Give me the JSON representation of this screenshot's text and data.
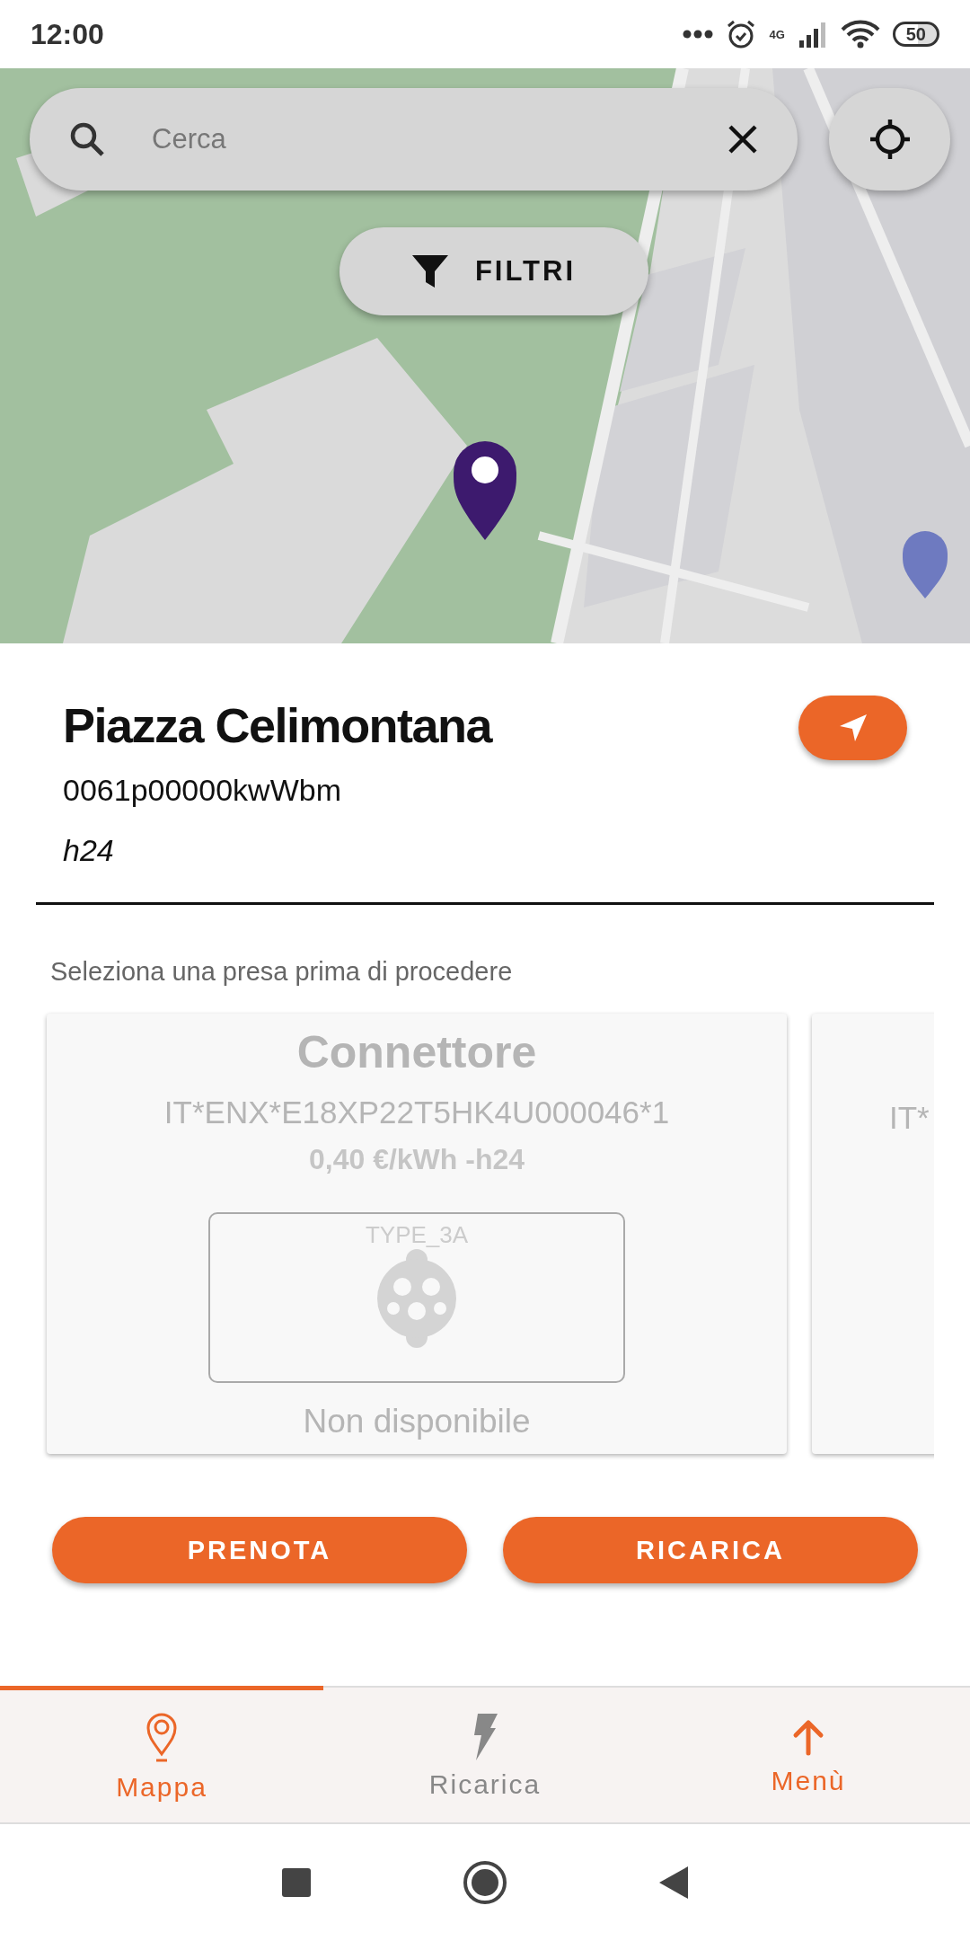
{
  "status_bar": {
    "time": "12:00",
    "network": "4G",
    "battery": "50"
  },
  "search": {
    "placeholder": "Cerca"
  },
  "filter_button": {
    "label": "FILTRI"
  },
  "map": {
    "kind": "picture"
  },
  "station": {
    "name": "Piazza Celimontana",
    "code": "0061p00000kwWbm",
    "hours": "h24"
  },
  "hint": "Seleziona una presa prima di procedere",
  "connectors": [
    {
      "title": "Connettore",
      "code": "IT*ENX*E18XP22T5HK4U000046*1",
      "price": "0,40 €/kWh -h24",
      "type": "TYPE_3A",
      "status": "Non disponibile",
      "available": false
    },
    {
      "code": "IT*",
      "available": false
    }
  ],
  "actions": [
    "PRENOTA",
    "RICARICA"
  ],
  "nav": [
    {
      "kind": "tab",
      "label": "Mappa",
      "selected": true
    },
    {
      "kind": "tab",
      "label": "Ricarica",
      "selected": false
    },
    {
      "kind": "menu",
      "label": "Menù"
    }
  ]
}
